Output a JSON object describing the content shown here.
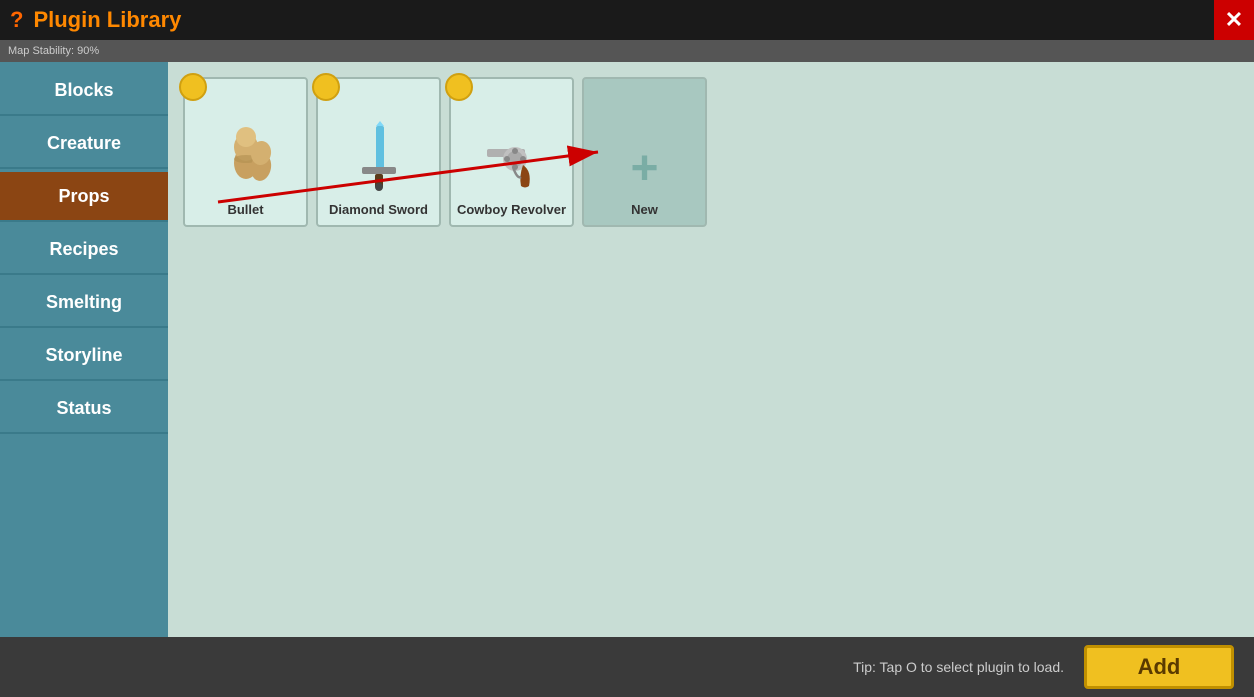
{
  "header": {
    "question_label": "?",
    "title": "Plugin Library",
    "close_label": "✕"
  },
  "breadcrumb": {
    "text": "Map Stability: 90%"
  },
  "sidebar": {
    "items": [
      {
        "id": "blocks",
        "label": "Blocks",
        "active": false
      },
      {
        "id": "creature",
        "label": "Creature",
        "active": false
      },
      {
        "id": "props",
        "label": "Props",
        "active": true
      },
      {
        "id": "recipes",
        "label": "Recipes",
        "active": false
      },
      {
        "id": "smelting",
        "label": "Smelting",
        "active": false
      },
      {
        "id": "storyline",
        "label": "Storyline",
        "active": false
      },
      {
        "id": "status",
        "label": "Status",
        "active": false
      }
    ]
  },
  "content": {
    "plugins": [
      {
        "id": "bullet",
        "label": "Bullet",
        "icon": "bullet",
        "has_badge": true
      },
      {
        "id": "diamond-sword",
        "label": "Diamond Sword",
        "icon": "sword",
        "has_badge": true
      },
      {
        "id": "cowboy-revolver",
        "label": "Cowboy Revolver",
        "icon": "revolver",
        "has_badge": true
      },
      {
        "id": "new",
        "label": "New",
        "icon": "plus",
        "has_badge": false
      }
    ]
  },
  "bottom": {
    "tip_text": "Tip: Tap O to select plugin to load.",
    "add_label": "Add"
  },
  "colors": {
    "header_bg": "#1a1a1a",
    "sidebar_bg": "#4a8a9a",
    "active_bg": "#8B4513",
    "content_bg": "#c8ddd5",
    "bottom_bg": "#3a3a3a",
    "add_btn_bg": "#f0c020"
  }
}
